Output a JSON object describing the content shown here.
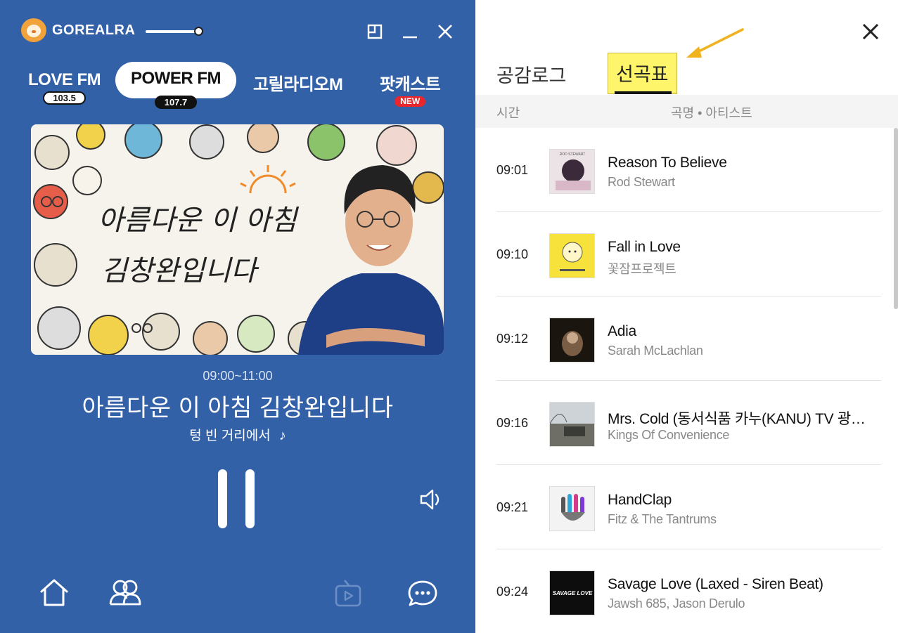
{
  "app": {
    "logo_text": "GOREALRA",
    "volume_level": 0.88
  },
  "stations": [
    {
      "name": "LOVE FM",
      "freq": "103.5"
    },
    {
      "name": "POWER FM",
      "freq": "107.7",
      "active": true
    },
    {
      "name": "고릴라디오M"
    },
    {
      "name": "팟캐스트",
      "badge": "NEW"
    }
  ],
  "show": {
    "time": "09:00~11:00",
    "title": "아름다운 이 아침 김창완입니다",
    "banner_text": [
      "아름다운 이 아침",
      "김창완입니다"
    ],
    "now_playing": "텅 빈 거리에서",
    "note_glyph": "♪"
  },
  "panel": {
    "tabs": {
      "log": "공감로그",
      "setlist": "선곡표"
    },
    "header": {
      "time": "시간",
      "title": "곡명 • 아티스트"
    },
    "tracks": [
      {
        "time": "09:01",
        "title": "Reason To Believe",
        "artist": "Rod Stewart",
        "cover": "rod"
      },
      {
        "time": "09:10",
        "title": "Fall in Love",
        "artist": "꽃잠프로젝트",
        "cover": "fall"
      },
      {
        "time": "09:12",
        "title": "Adia",
        "artist": "Sarah McLachlan",
        "cover": "adia"
      },
      {
        "time": "09:16",
        "title": "Mrs. Cold (동서식품 카누(KANU) TV 광고 삽입곡)",
        "artist": "Kings Of Convenience",
        "cover": "kings"
      },
      {
        "time": "09:21",
        "title": "HandClap",
        "artist": "Fitz & The Tantrums",
        "cover": "hand"
      },
      {
        "time": "09:24",
        "title": "Savage Love (Laxed - Siren Beat)",
        "artist": "Jawsh 685, Jason Derulo",
        "cover": "savage"
      }
    ]
  },
  "colors": {
    "player_bg": "#3361a8",
    "highlight": "#fff56a",
    "arrow": "#f0b31d",
    "new_badge": "#e8262b"
  }
}
